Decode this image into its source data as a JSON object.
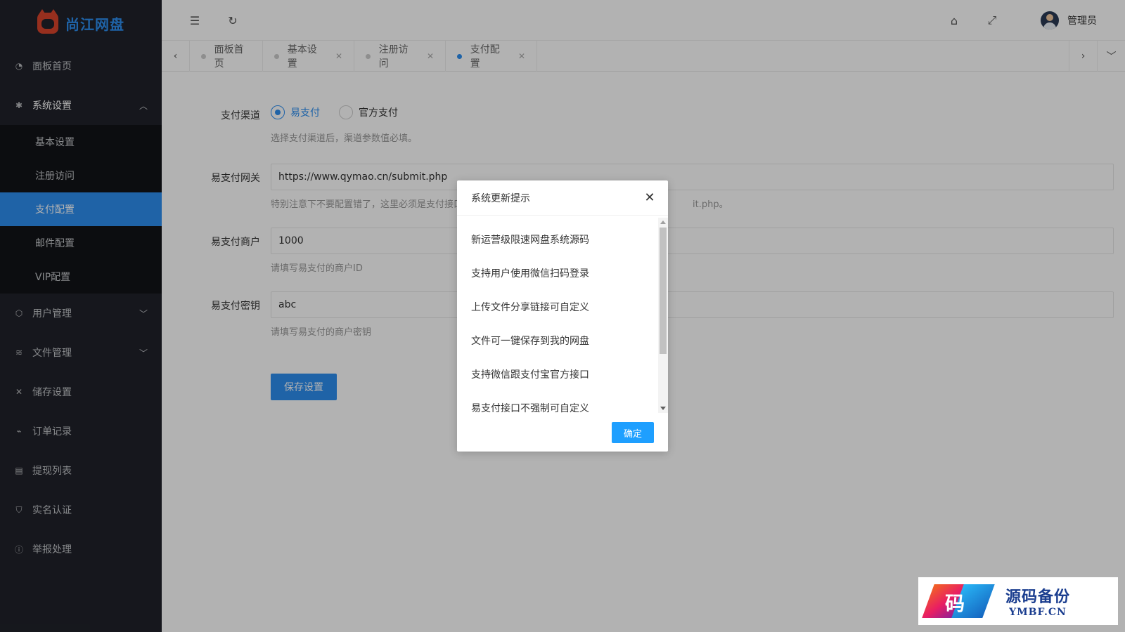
{
  "brand": {
    "name": "尚江网盘"
  },
  "sidebar": {
    "items": [
      {
        "label": "面板首页",
        "icon": "dashboard-icon"
      },
      {
        "label": "系统设置",
        "icon": "gear-icon",
        "open": true,
        "children": [
          "基本设置",
          "注册访问",
          "支付配置",
          "邮件配置",
          "VIP配置"
        ],
        "active_child": "支付配置"
      },
      {
        "label": "用户管理",
        "icon": "cube-icon"
      },
      {
        "label": "文件管理",
        "icon": "layers-icon"
      },
      {
        "label": "储存设置",
        "icon": "tools-icon"
      },
      {
        "label": "订单记录",
        "icon": "pulse-icon"
      },
      {
        "label": "提现列表",
        "icon": "list-icon"
      },
      {
        "label": "实名认证",
        "icon": "shield-check-icon"
      },
      {
        "label": "举报处理",
        "icon": "info-icon"
      }
    ]
  },
  "header": {
    "user_name": "管理员"
  },
  "tabs": [
    {
      "label": "面板首页",
      "closable": false
    },
    {
      "label": "基本设置",
      "closable": true
    },
    {
      "label": "注册访问",
      "closable": true
    },
    {
      "label": "支付配置",
      "closable": true,
      "active": true
    }
  ],
  "form": {
    "channel": {
      "label": "支付渠道",
      "options": [
        "易支付",
        "官方支付"
      ],
      "selected": "易支付",
      "hint": "选择支付渠道后，渠道参数值必填。"
    },
    "gateway": {
      "label": "易支付网关",
      "value": "https://www.qymao.cn/submit.php",
      "hint_left": "特别注意下不要配置错了，这里必须是支付接口",
      "hint_right": "it.php。"
    },
    "merchant": {
      "label": "易支付商户",
      "value": "1000",
      "hint": "请填写易支付的商户ID"
    },
    "secret": {
      "label": "易支付密钥",
      "value": "abc",
      "hint": "请填写易支付的商户密钥"
    },
    "save_label": "保存设置"
  },
  "modal": {
    "title": "系统更新提示",
    "items": [
      "新运营级限速网盘系统源码",
      "支持用户使用微信扫码登录",
      "上传文件分享链接可自定义",
      "文件可一键保存到我的网盘",
      "支持微信跟支付宝官方接口",
      "易支付接口不强制可自定义"
    ],
    "confirm_label": "确定"
  },
  "watermark": {
    "cn": "源码备份",
    "en": "YMBF.CN",
    "glyph": "码"
  },
  "colors": {
    "accent": "#2d8ef0",
    "sidebar_bg": "#20222a",
    "submenu_bg": "#121317",
    "confirm": "#1e9fff"
  }
}
